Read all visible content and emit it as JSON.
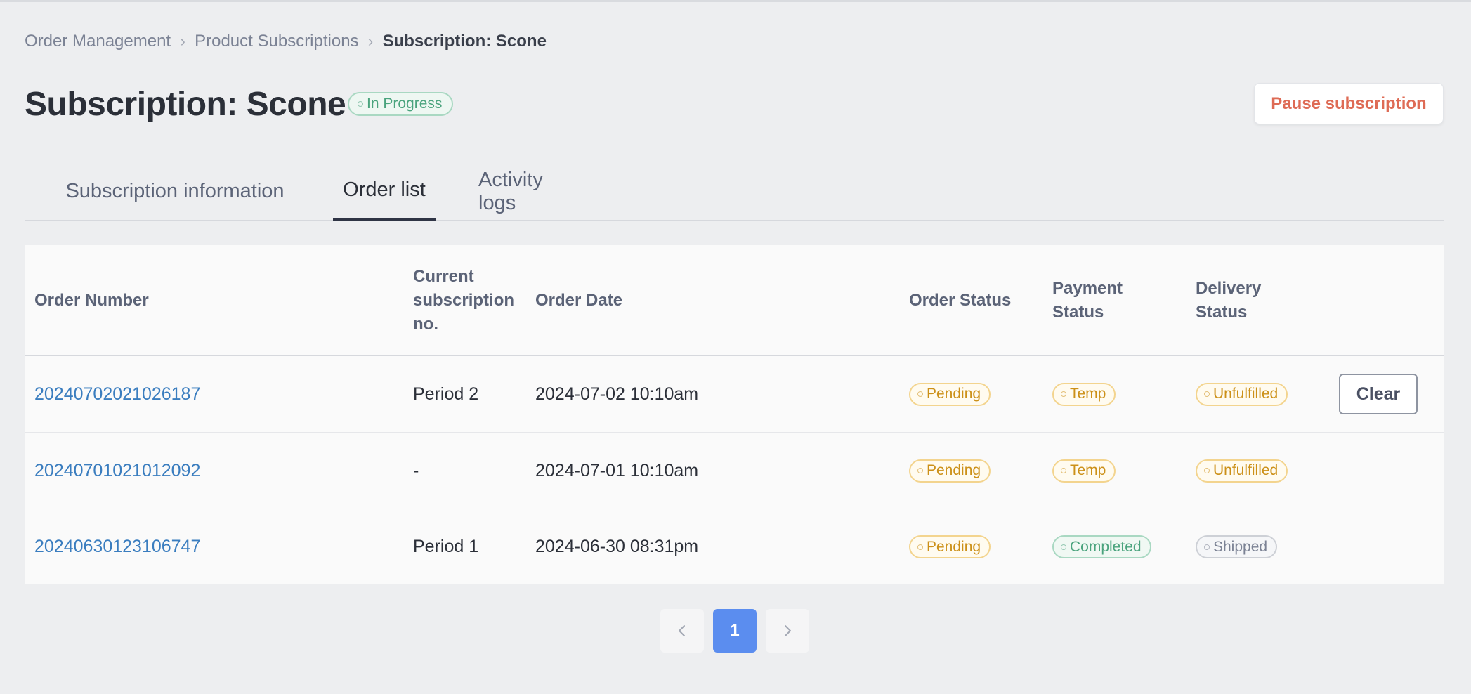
{
  "breadcrumb": {
    "items": [
      "Order Management",
      "Product Subscriptions",
      "Subscription: Scone"
    ]
  },
  "header": {
    "title": "Subscription: Scone",
    "status": "In Progress",
    "pause_label": "Pause subscription"
  },
  "tabs": [
    {
      "label": "Subscription information",
      "active": false
    },
    {
      "label": "Order list",
      "active": true
    },
    {
      "label": "Activity logs",
      "active": false
    }
  ],
  "table": {
    "columns": [
      "Order Number",
      "Current subscription no.",
      "Order Date",
      "Order Status",
      "Payment Status",
      "Delivery Status"
    ],
    "rows": [
      {
        "order_number": "20240702021026187",
        "subscription_no": "Period 2",
        "order_date": "2024-07-02 10:10am",
        "order_status": "Pending",
        "payment_status": "Temp",
        "delivery_status": "Unfulfilled",
        "action": "Clear"
      },
      {
        "order_number": "20240701021012092",
        "subscription_no": "-",
        "order_date": "2024-07-01 10:10am",
        "order_status": "Pending",
        "payment_status": "Temp",
        "delivery_status": "Unfulfilled"
      },
      {
        "order_number": "20240630123106747",
        "subscription_no": "Period 1",
        "order_date": "2024-06-30 08:31pm",
        "order_status": "Pending",
        "payment_status": "Completed",
        "delivery_status": "Shipped"
      }
    ]
  },
  "pagination": {
    "current_page": "1",
    "prev_icon": "chevron-left-icon",
    "next_icon": "chevron-right-icon"
  },
  "colors": {
    "accent": "#5b8def",
    "danger_text": "#de6b55",
    "link": "#3a7dbf",
    "pending": "#cc9018",
    "success": "#4aa37d",
    "neutral": "#7b8294"
  }
}
